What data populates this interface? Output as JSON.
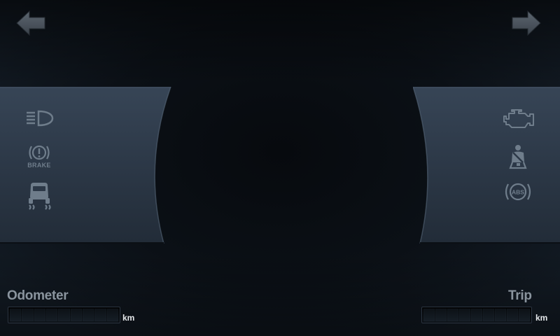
{
  "navigation": {
    "back_icon": "arrow-left-icon",
    "forward_icon": "arrow-right-icon"
  },
  "left_indicators": [
    {
      "icon": "high-beam-headlight-icon"
    },
    {
      "icon": "brake-warning-icon",
      "text": "BRAKE"
    },
    {
      "icon": "traction-control-icon"
    }
  ],
  "right_indicators": [
    {
      "icon": "check-engine-icon"
    },
    {
      "icon": "seatbelt-icon"
    },
    {
      "icon": "abs-warning-icon",
      "text": "ABS"
    }
  ],
  "odometer": {
    "label": "Odometer",
    "unit": "km",
    "digit_count": 9
  },
  "trip": {
    "label": "Trip",
    "unit": "km",
    "digit_count": 9
  },
  "colors": {
    "indicator_inactive": "#6f7d8b",
    "label": "#8a949e",
    "unit": "#e6e9ec",
    "panel": "#2b3644"
  }
}
